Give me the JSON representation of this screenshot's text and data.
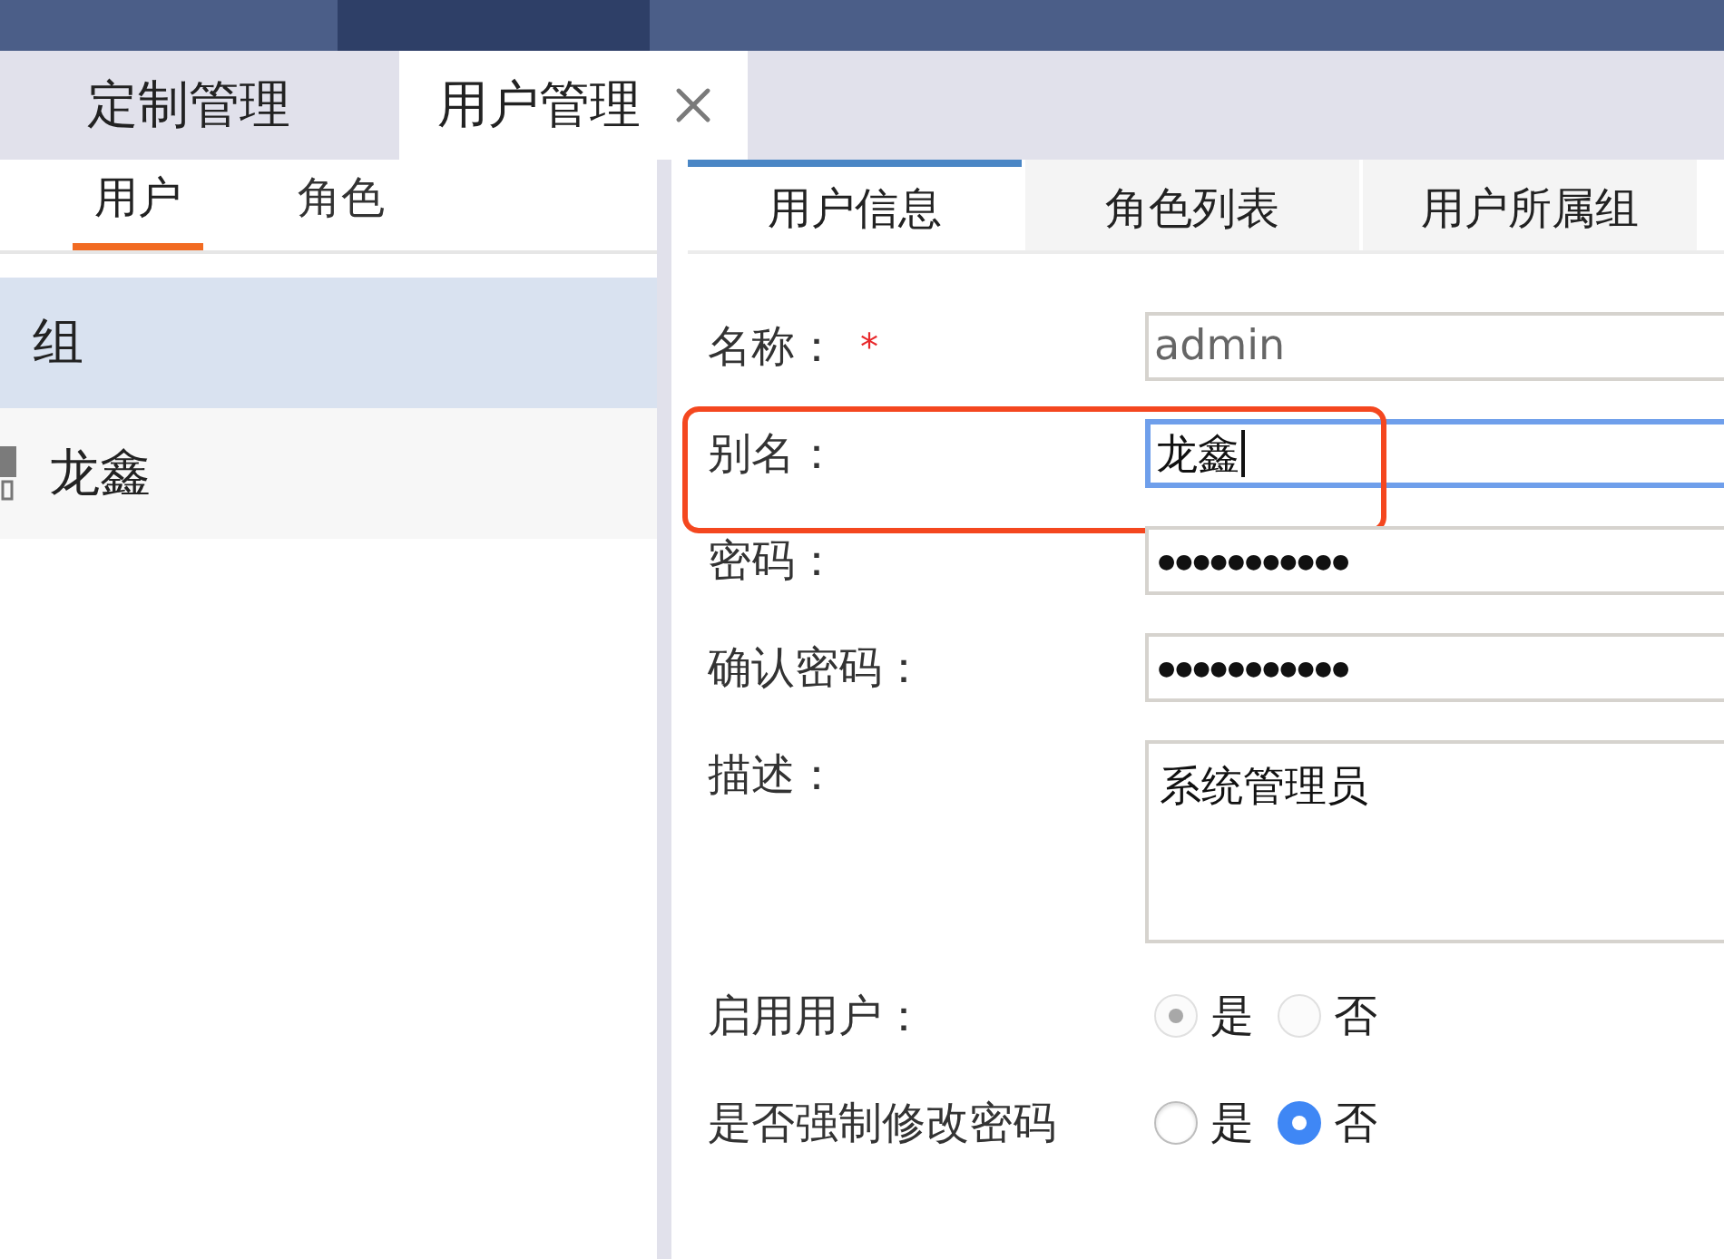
{
  "page_tabs": [
    {
      "label": "定制管理",
      "selected": false,
      "closable": false
    },
    {
      "label": "用户管理",
      "selected": true,
      "closable": true
    }
  ],
  "sidebar": {
    "tabs": [
      {
        "label": "用户",
        "selected": true
      },
      {
        "label": "角色",
        "selected": false
      }
    ],
    "tree": [
      {
        "label": "组",
        "selected": true,
        "children": [
          {
            "label": "龙鑫",
            "selected": false
          }
        ]
      }
    ]
  },
  "detail_tabs": [
    {
      "label": "用户信息",
      "selected": true
    },
    {
      "label": "角色列表",
      "selected": false
    },
    {
      "label": "用户所属组",
      "selected": false
    }
  ],
  "user_form": {
    "fields": [
      {
        "label": "名称：",
        "required_mark": "*",
        "kind": "text",
        "value": "admin",
        "disabled": true,
        "focused": false,
        "highlighted": false
      },
      {
        "label": "别名：",
        "kind": "text",
        "value": "龙鑫",
        "disabled": false,
        "focused": true,
        "highlighted": true
      },
      {
        "label": "密码：",
        "kind": "password",
        "value": "●●●●●●●●●●●",
        "disabled": false,
        "focused": false,
        "highlighted": false
      },
      {
        "label": "确认密码：",
        "kind": "password",
        "value": "●●●●●●●●●●●",
        "disabled": false,
        "focused": false,
        "highlighted": false
      },
      {
        "label": "描述：",
        "kind": "textarea",
        "value": "系统管理员",
        "disabled": false,
        "focused": false,
        "highlighted": false
      }
    ],
    "options": [
      {
        "label": "启用用户：",
        "disabled": true,
        "choices": [
          {
            "label": "是",
            "selected": true
          },
          {
            "label": "否",
            "selected": false
          }
        ]
      },
      {
        "label": "是否强制修改密码",
        "disabled": false,
        "choices": [
          {
            "label": "是",
            "selected": false
          },
          {
            "label": "否",
            "selected": true
          }
        ]
      }
    ]
  }
}
